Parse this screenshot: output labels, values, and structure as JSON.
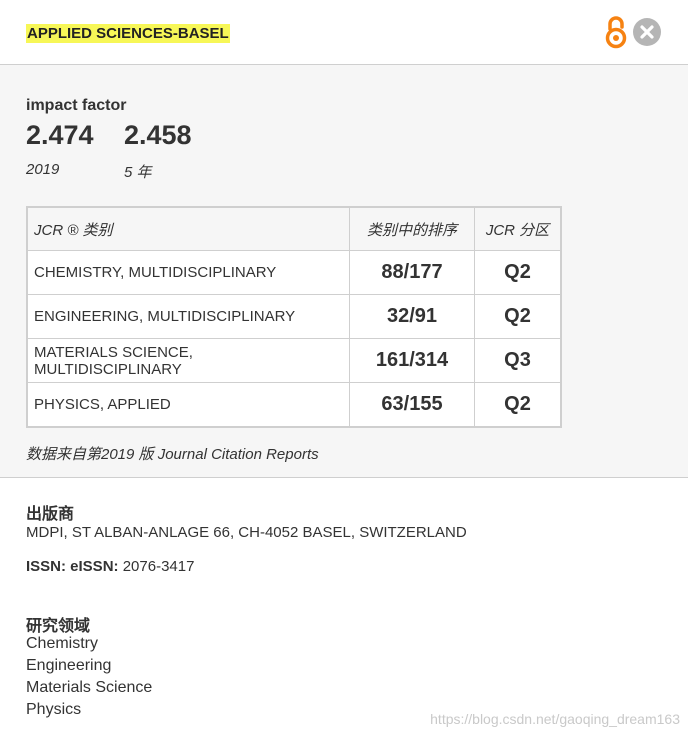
{
  "header": {
    "journal_title": "APPLIED SCIENCES-BASEL"
  },
  "metrics": {
    "impact_factor_label": "impact factor",
    "values": [
      {
        "value": "2.474",
        "period": "2019"
      },
      {
        "value": "2.458",
        "period": "5 年"
      }
    ],
    "table": {
      "headers": [
        "JCR ® 类别",
        "类别中的排序",
        "JCR 分区"
      ],
      "rows": [
        {
          "category": "CHEMISTRY, MULTIDISCIPLINARY",
          "rank": "88/177",
          "quartile": "Q2"
        },
        {
          "category": "ENGINEERING, MULTIDISCIPLINARY",
          "rank": "32/91",
          "quartile": "Q2"
        },
        {
          "category": "MATERIALS SCIENCE, MULTIDISCIPLINARY",
          "rank": "161/314",
          "quartile": "Q3"
        },
        {
          "category": "PHYSICS, APPLIED",
          "rank": "63/155",
          "quartile": "Q2"
        }
      ]
    },
    "source_note": "数据来自第2019 版 Journal Citation Reports"
  },
  "publisher": {
    "title": "出版商",
    "address": "MDPI, ST ALBAN-ANLAGE 66, CH-4052 BASEL, SWITZERLAND"
  },
  "issn": {
    "label": "ISSN: eISSN:",
    "value": " 2076-3417"
  },
  "research_areas": {
    "title": "研究领域",
    "items": [
      "Chemistry",
      "Engineering",
      "Materials Science",
      "Physics"
    ]
  },
  "watermark": "https://blog.csdn.net/gaoqing_dream163",
  "colors": {
    "highlight": "#f7f757",
    "open_access_orange": "#f68212",
    "close_gray": "#b5b5b5",
    "panel_bg": "#f6f6f6"
  },
  "icons": [
    "open-access-icon",
    "close-icon"
  ]
}
